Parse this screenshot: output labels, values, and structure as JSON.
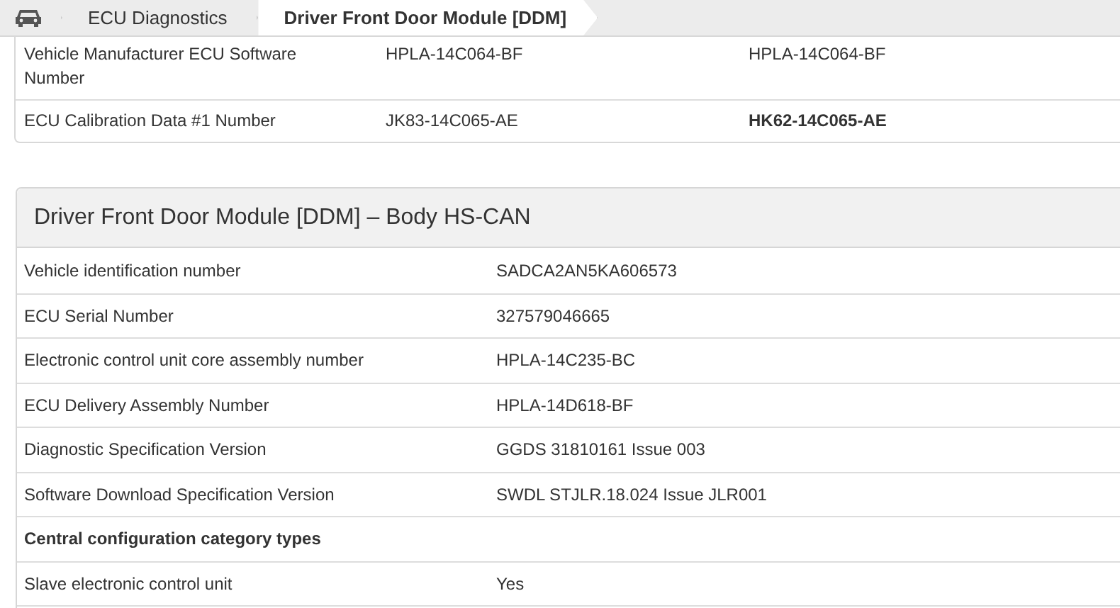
{
  "breadcrumbs": [
    {
      "kind": "home",
      "selected": false
    },
    {
      "kind": "text",
      "label": "ECU Diagnostics",
      "selected": false
    },
    {
      "kind": "text",
      "label": "Driver Front Door Module [DDM]",
      "selected": true
    }
  ],
  "previous_card": {
    "rows": [
      {
        "label": "Vehicle Manufacturer ECU Software Number",
        "value_1": "HPLA-14C064-BF",
        "value_2": "HPLA-14C064-BF",
        "highlighted": false
      },
      {
        "label": "ECU Calibration Data #1 Number",
        "value_1": "JK83-14C065-AE",
        "value_2": "HK62-14C065-AE",
        "highlighted": true
      }
    ]
  },
  "module_card": {
    "title": "Driver Front Door Module [DDM] – Body HS-CAN",
    "rows": [
      {
        "kind": "field",
        "label": "Vehicle identification number",
        "value": "SADCA2AN5KA606573"
      },
      {
        "kind": "field",
        "label": "ECU Serial Number",
        "value": "327579046665"
      },
      {
        "kind": "field",
        "label": "Electronic control unit core assembly number",
        "value": "HPLA-14C235-BC"
      },
      {
        "kind": "field",
        "label": "ECU Delivery Assembly Number",
        "value": "HPLA-14D618-BF"
      },
      {
        "kind": "field",
        "label": "Diagnostic Specification Version",
        "value": "GGDS 31810161 Issue 003"
      },
      {
        "kind": "field",
        "label": "Software Download Specification Version",
        "value": "SWDL STJLR.18.024 Issue JLR001"
      },
      {
        "kind": "section",
        "label": "Central configuration category types"
      },
      {
        "kind": "field",
        "label": "Slave electronic control unit",
        "value": "Yes"
      }
    ]
  }
}
